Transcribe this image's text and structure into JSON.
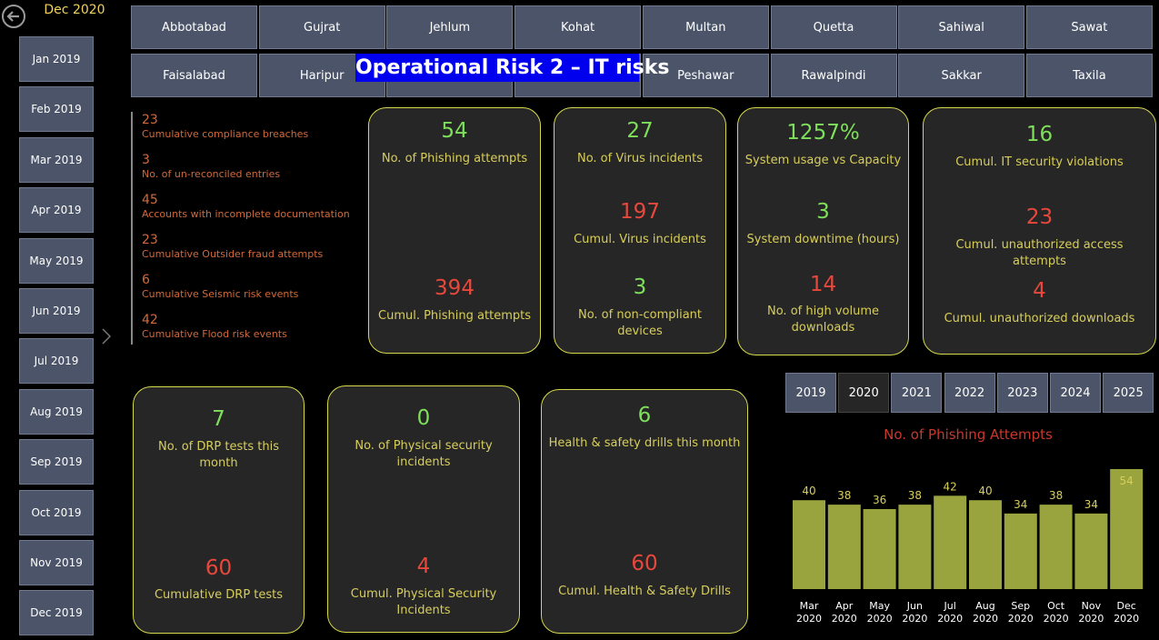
{
  "header": {
    "selected_month": "Dec 2020",
    "title": "Operational Risk 2 – IT risks"
  },
  "months": [
    "Jan 2019",
    "Feb 2019",
    "Mar 2019",
    "Apr 2019",
    "May 2019",
    "Jun 2019",
    "Jul 2019",
    "Aug 2019",
    "Sep 2019",
    "Oct 2019",
    "Nov 2019",
    "Dec 2019"
  ],
  "cities_row1": [
    "Abbotabad",
    "Gujrat",
    "Jehlum",
    "Kohat",
    "Multan",
    "Quetta",
    "Sahiwal",
    "Sawat"
  ],
  "cities_row2": [
    "Faisalabad",
    "Haripur",
    "",
    "",
    "Peshawar",
    "Rawalpindi",
    "Sakkar",
    "Taxila"
  ],
  "metrics": [
    {
      "value": "23",
      "label": "Cumulative compliance breaches"
    },
    {
      "value": "3",
      "label": "No. of un-reconciled entries"
    },
    {
      "value": "45",
      "label": "Accounts with incomplete documentation"
    },
    {
      "value": "23",
      "label": "Cumulative Outsider fraud attempts"
    },
    {
      "value": "6",
      "label": "Cumulative Seismic risk events"
    },
    {
      "value": "42",
      "label": "Cumulative Flood risk events"
    }
  ],
  "kpi": {
    "phishing": {
      "v1": "54",
      "l1": "No. of Phishing attempts",
      "v2": "394",
      "l2": "Cumul. Phishing attempts"
    },
    "virus": {
      "v1": "27",
      "l1": "No. of Virus incidents",
      "v2": "197",
      "l2": "Cumul. Virus incidents",
      "v3": "3",
      "l3": "No. of non-compliant devices"
    },
    "system": {
      "v1": "1257%",
      "l1": "System usage vs Capacity",
      "v2": "3",
      "l2": "System downtime (hours)",
      "v3": "14",
      "l3": "No. of high volume downloads"
    },
    "security": {
      "v1": "16",
      "l1": "Cumul. IT security violations",
      "v2": "23",
      "l2": "Cumul. unauthorized access attempts",
      "v3": "4",
      "l3": "Cumul. unauthorized downloads"
    },
    "drp": {
      "v1": "7",
      "l1": "No. of DRP tests this month",
      "v2": "60",
      "l2": "Cumulative DRP tests"
    },
    "physical": {
      "v1": "0",
      "l1": "No. of Physical security incidents",
      "v2": "4",
      "l2": "Cumul. Physical Security Incidents"
    },
    "health": {
      "v1": "6",
      "l1": "Health & safety drills this month",
      "v2": "60",
      "l2": "Cumul. Health & Safety Drills"
    }
  },
  "years": [
    "2019",
    "2020",
    "2021",
    "2022",
    "2023",
    "2024",
    "2025"
  ],
  "active_year": "2020",
  "chart_data": {
    "type": "bar",
    "title": "No. of Phishing Attempts",
    "categories": [
      [
        "Mar",
        "2020"
      ],
      [
        "Apr",
        "2020"
      ],
      [
        "May",
        "2020"
      ],
      [
        "Jun",
        "2020"
      ],
      [
        "Jul",
        "2020"
      ],
      [
        "Aug",
        "2020"
      ],
      [
        "Sep",
        "2020"
      ],
      [
        "Oct",
        "2020"
      ],
      [
        "Nov",
        "2020"
      ],
      [
        "Dec",
        "2020"
      ]
    ],
    "values": [
      40,
      38,
      36,
      38,
      42,
      40,
      34,
      38,
      34,
      54
    ],
    "ylim": [
      0,
      54
    ],
    "bar_color": "#9aa43e",
    "label_color": "#d8ce5a",
    "highlight_index": 9
  }
}
